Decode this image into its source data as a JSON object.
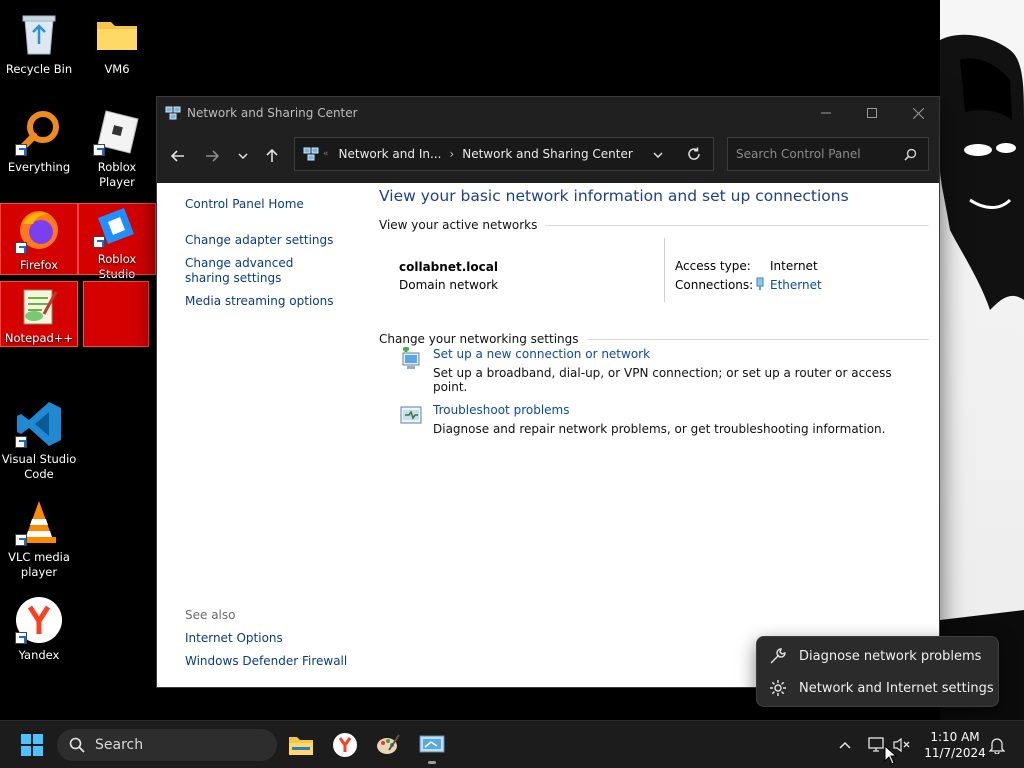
{
  "desktop": {
    "icons": [
      {
        "label": "Recycle Bin"
      },
      {
        "label": "VM6"
      },
      {
        "label": "Everything"
      },
      {
        "label": "Roblox Player"
      },
      {
        "label": "Firefox"
      },
      {
        "label": "Roblox Studio"
      },
      {
        "label": "Notepad++"
      },
      {
        "label": ""
      },
      {
        "label": "Visual Studio Code"
      },
      {
        "label": "VLC media player"
      },
      {
        "label": "Yandex"
      }
    ]
  },
  "window": {
    "title": "Network and Sharing Center",
    "address": {
      "crumbs": [
        "Network and In...",
        "Network and Sharing Center"
      ]
    },
    "search_placeholder": "Search Control Panel"
  },
  "left_nav": {
    "items": [
      {
        "label": "Control Panel Home"
      },
      {
        "label": "Change adapter settings"
      },
      {
        "label": "Change advanced sharing settings"
      },
      {
        "label": "Media streaming options"
      }
    ],
    "see_also_label": "See also",
    "see_also": [
      {
        "label": "Internet Options"
      },
      {
        "label": "Windows Defender Firewall"
      }
    ]
  },
  "main": {
    "heading": "View your basic network information and set up connections",
    "active_networks_label": "View your active networks",
    "network": {
      "name": "collabnet.local",
      "type": "Domain network",
      "access_type_label": "Access type:",
      "access_type_value": "Internet",
      "connections_label": "Connections:",
      "connections_value": "Ethernet"
    },
    "change_settings_label": "Change your networking settings",
    "tasks": [
      {
        "title": "Set up a new connection or network",
        "desc": "Set up a broadband, dial-up, or VPN connection; or set up a router or access point."
      },
      {
        "title": "Troubleshoot problems",
        "desc": "Diagnose and repair network problems, or get troubleshooting information."
      }
    ]
  },
  "flyout": {
    "items": [
      {
        "label": "Diagnose network problems"
      },
      {
        "label": "Network and Internet settings"
      }
    ]
  },
  "taskbar": {
    "search_label": "Search",
    "time": "1:10 AM",
    "date": "11/7/2024"
  },
  "colors": {
    "link": "#0b4aa6",
    "heading": "#1d3f8f",
    "selected_icon_bg": "#d50000",
    "titlebar": "#202020",
    "taskbar": "#1c1c1c"
  }
}
